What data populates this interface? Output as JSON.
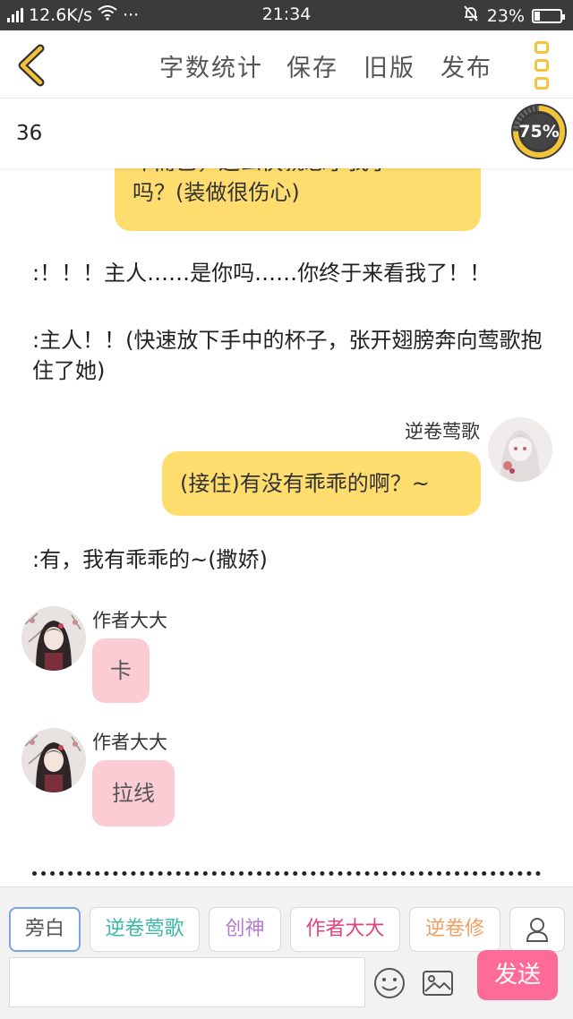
{
  "status_bar": {
    "network_type": "4G",
    "speed": "12.6K/s",
    "more": "···",
    "time": "21:34",
    "battery_percent": "23%",
    "battery_level": 0.23
  },
  "nav": {
    "word_count": "字数统计",
    "save": "保存",
    "old_version": "旧版",
    "publish": "发布"
  },
  "count_row": {
    "count": "36",
    "progress_label": "75%",
    "progress_value": 0.75
  },
  "chat": {
    "partial_bubble_line1": "年而已，这么快就忘了我了",
    "partial_bubble_line2": "吗？(装做很伤心)",
    "narration_1": ":！！！主人……是你吗……你终于来看我了！！",
    "narration_2": ":主人！！(快速放下手中的杯子，张开翅膀奔向莺歌抱住了她)",
    "right_speaker": "逆卷莺歌",
    "right_message": "(接住)有没有乖乖的啊？~",
    "narration_3": ":有，我有乖乖的~(撒娇)",
    "author_name_1": "作者大大",
    "author_message_1": "卡",
    "author_name_2": "作者大大",
    "author_message_2": "拉线",
    "ellipsis_line": "……………………………………………………"
  },
  "characters": [
    {
      "label": "旁白",
      "color": "#555555"
    },
    {
      "label": "逆卷莺歌",
      "color": "#3bb8a5"
    },
    {
      "label": "创神",
      "color": "#b67ad1"
    },
    {
      "label": "作者大大",
      "color": "#e0447e"
    },
    {
      "label": "逆卷修",
      "color": "#f0a061"
    }
  ],
  "composer": {
    "input_value": "",
    "send": "发送"
  },
  "colors": {
    "accent_yellow": "#f3c43a",
    "bubble_yellow": "#ffdc6e",
    "bubble_pink": "#fcccd4",
    "send_pink": "#ff6b97",
    "status_bar": "#3b3b3b"
  },
  "icons": [
    "signal-icon",
    "wifi-icon",
    "mute-bell-icon",
    "battery-icon",
    "back-chevron-icon",
    "more-menu-icon",
    "add-character-icon",
    "emoji-icon",
    "image-icon"
  ]
}
